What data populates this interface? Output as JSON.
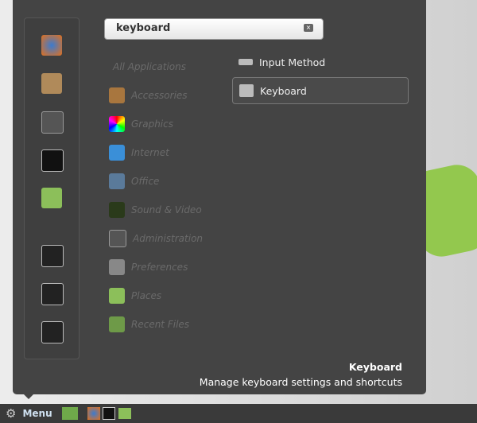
{
  "search": {
    "value": "keyboard"
  },
  "favorites": [
    {
      "icon": "firefox-icon"
    },
    {
      "icon": "package-manager-icon"
    },
    {
      "icon": "system-settings-icon"
    },
    {
      "icon": "terminal-icon"
    },
    {
      "icon": "folder-icon"
    },
    {
      "icon": "lock-screen-icon"
    },
    {
      "icon": "logout-icon"
    },
    {
      "icon": "shutdown-icon"
    }
  ],
  "categories": [
    "All Applications",
    "Accessories",
    "Graphics",
    "Internet",
    "Office",
    "Sound & Video",
    "Administration",
    "Preferences",
    "Places",
    "Recent Files"
  ],
  "results": [
    "Input Method",
    "Keyboard"
  ],
  "description": {
    "title": "Keyboard",
    "text": "Manage keyboard settings and shortcuts"
  },
  "panel": {
    "menu_label": "Menu"
  }
}
